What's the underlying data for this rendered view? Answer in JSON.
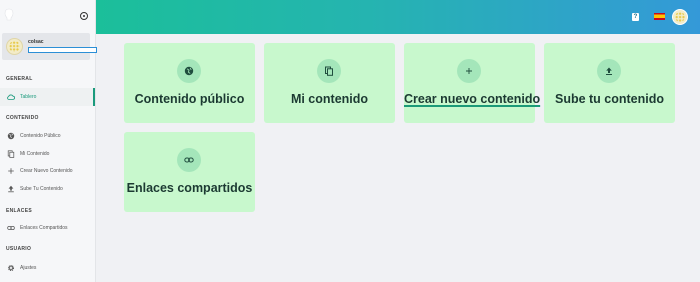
{
  "sidebar": {
    "user": {
      "name": "colsac"
    },
    "sections": {
      "general": "GENERAL",
      "contenido": "CONTENIDO",
      "enlaces": "ENLACES",
      "usuario": "USUARIO"
    },
    "items": [
      {
        "label": "Tablero",
        "icon": "cloud-icon",
        "active": true
      },
      {
        "label": "Contenido Público",
        "icon": "globe-icon"
      },
      {
        "label": "Mi Contenido",
        "icon": "copy-icon"
      },
      {
        "label": "Crear Nuevo Contenido",
        "icon": "plus-icon"
      },
      {
        "label": "Sube Tu Contenido",
        "icon": "upload-icon"
      },
      {
        "label": "Enlaces Compartidos",
        "icon": "link-icon"
      },
      {
        "label": "Ajustes",
        "icon": "gear-icon"
      }
    ]
  },
  "header": {
    "help_label": "?",
    "language": "es",
    "colors": {
      "gradient_start": "#1bbf9a",
      "gradient_end": "#3499d8"
    }
  },
  "cards": [
    {
      "title": "Contenido público",
      "icon": "globe-icon"
    },
    {
      "title": "Mi contenido",
      "icon": "copy-icon"
    },
    {
      "title": "Crear nuevo contenido",
      "icon": "plus-icon"
    },
    {
      "title": "Sube tu contenido",
      "icon": "upload-icon"
    },
    {
      "title": "Enlaces compartidos",
      "icon": "link-icon"
    }
  ]
}
